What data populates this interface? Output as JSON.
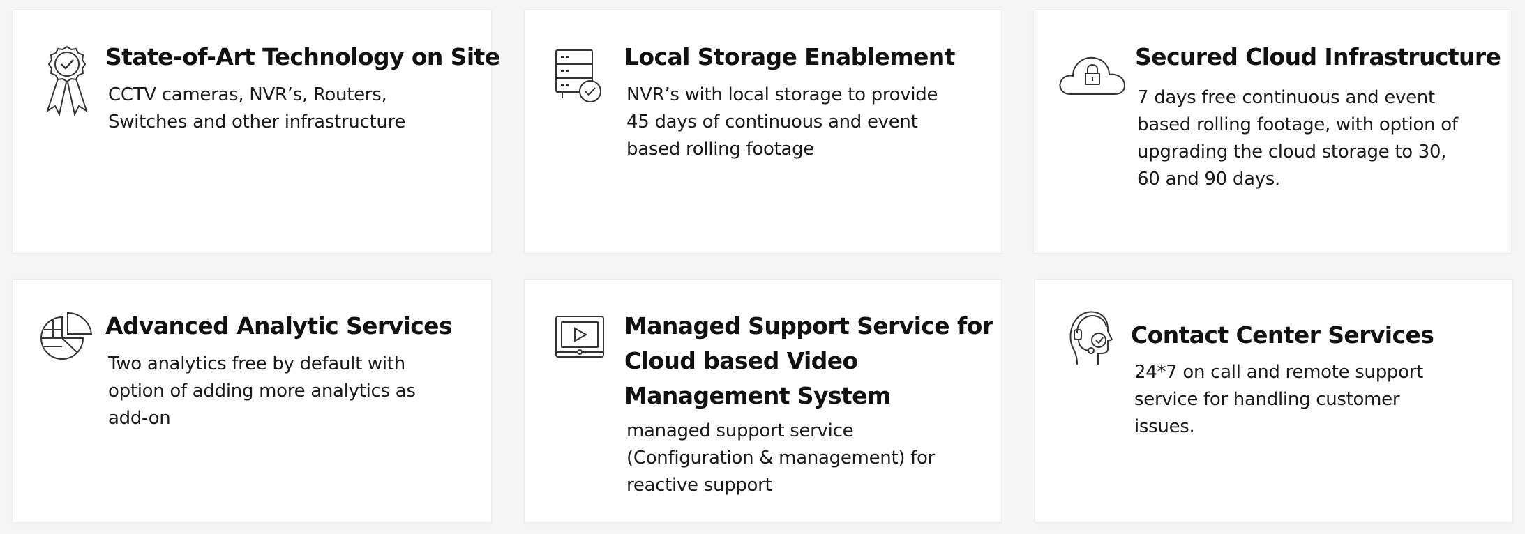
{
  "services": [
    {
      "title": "State-of-Art Technology on Site",
      "description": "CCTV cameras, NVR’s, Routers, Switches and other infrastructure",
      "icon": "award-ribbon-icon"
    },
    {
      "title": "Local Storage Enablement",
      "description": "NVR’s with local storage to provide 45 days of continuous and event based rolling footage",
      "icon": "server-storage-icon"
    },
    {
      "title": "Secured Cloud Infrastructure",
      "description": "7 days free continuous and event based rolling footage, with option of upgrading the cloud storage to 30, 60 and 90 days.",
      "icon": "cloud-lock-icon"
    },
    {
      "title": "Advanced Analytic Services",
      "description": "Two analytics free by default with option of adding more analytics as add-on",
      "icon": "pie-chart-icon"
    },
    {
      "title_lines": [
        "Managed Support Service for",
        "Cloud based Video",
        "Management System"
      ],
      "description": "managed support service (Configuration & management) for reactive support",
      "icon": "video-monitor-icon"
    },
    {
      "title": "Contact Center Services",
      "description": "24*7 on call and remote support service for handling customer issues.",
      "icon": "headset-agent-icon"
    }
  ],
  "colors": {
    "background": "#f6f6f6",
    "card": "#ffffff",
    "card_border": "#ececec",
    "title": "#111111",
    "text": "#1a1a1a",
    "icon": "#333333"
  }
}
